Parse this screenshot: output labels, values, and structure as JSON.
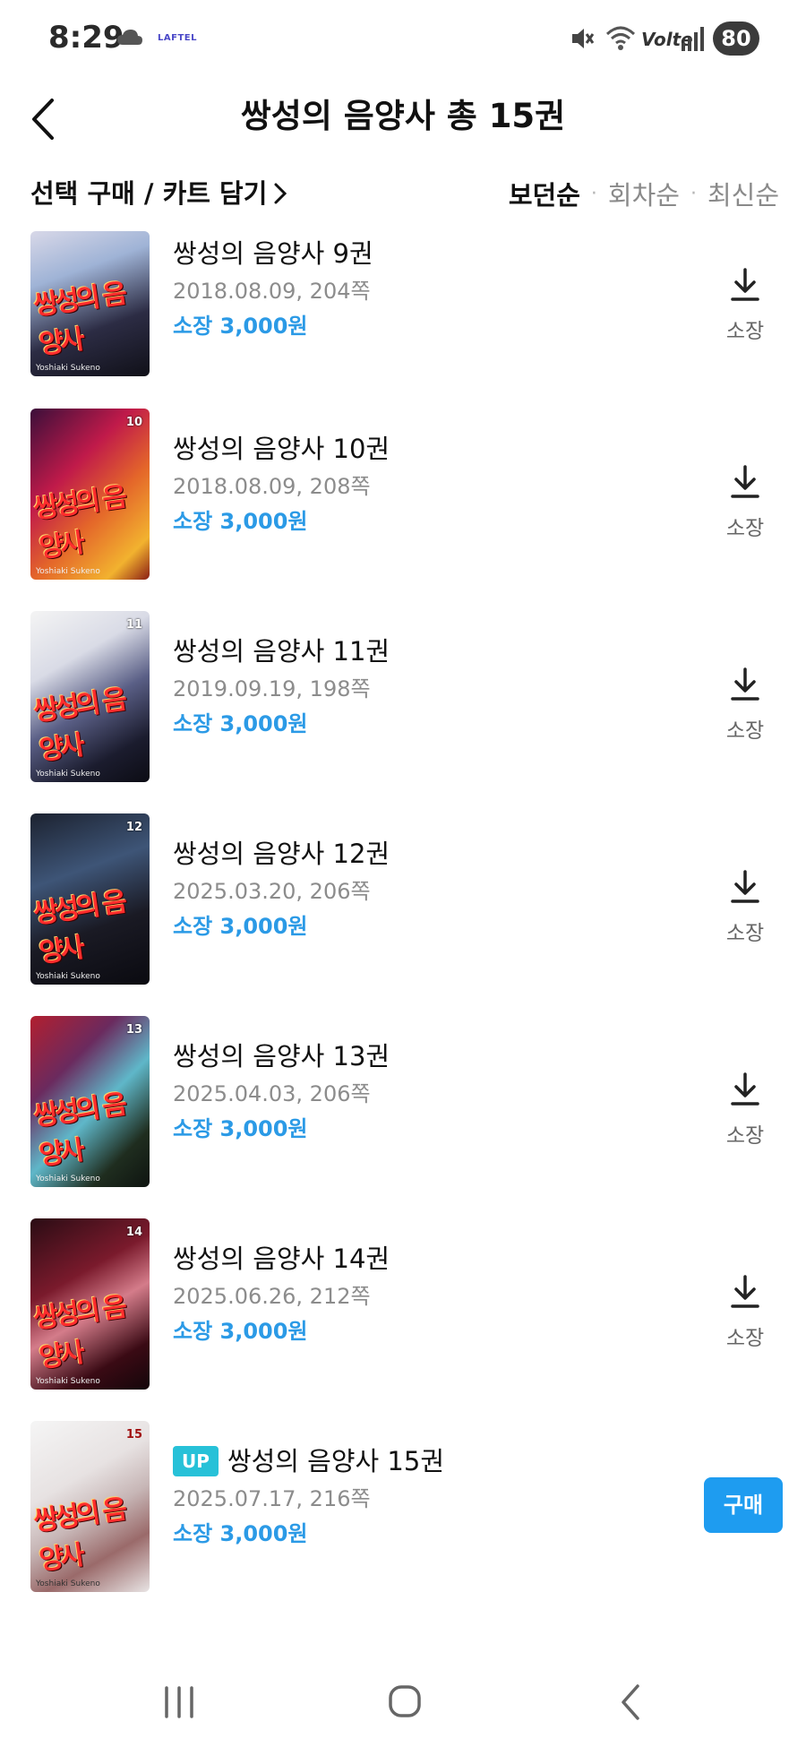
{
  "status_bar": {
    "time": "8:29",
    "app_label": "LAFTEL",
    "network": "Volte",
    "battery": "80"
  },
  "header": {
    "title": "쌍성의 음양사 총 15권"
  },
  "actions": {
    "select_label": "선택 구매 / 카트 담기",
    "sort_options": [
      "보던순",
      "회차순",
      "최신순"
    ]
  },
  "colors": {
    "accent_blue": "#2b9ae6",
    "buy_blue": "#1e9cf0",
    "up_badge": "#27c1d8"
  },
  "books": [
    {
      "title": "쌍성의 음양사 9권",
      "meta": "2018.08.09, 204쪽",
      "price": "소장 3,000원",
      "action_label": "소장",
      "action": "download",
      "volume": "9",
      "cover_text": "쌍성의 음양사",
      "cover_author": "Yoshiaki Sukeno"
    },
    {
      "title": "쌍성의 음양사 10권",
      "meta": "2018.08.09, 208쪽",
      "price": "소장 3,000원",
      "action_label": "소장",
      "action": "download",
      "volume": "10",
      "cover_text": "쌍성의 음양사",
      "cover_author": "Yoshiaki Sukeno"
    },
    {
      "title": "쌍성의 음양사 11권",
      "meta": "2019.09.19, 198쪽",
      "price": "소장 3,000원",
      "action_label": "소장",
      "action": "download",
      "volume": "11",
      "cover_text": "쌍성의 음양사",
      "cover_author": "Yoshiaki Sukeno"
    },
    {
      "title": "쌍성의 음양사 12권",
      "meta": "2025.03.20, 206쪽",
      "price": "소장 3,000원",
      "action_label": "소장",
      "action": "download",
      "volume": "12",
      "cover_text": "쌍성의 음양사",
      "cover_author": "Yoshiaki Sukeno"
    },
    {
      "title": "쌍성의 음양사 13권",
      "meta": "2025.04.03, 206쪽",
      "price": "소장 3,000원",
      "action_label": "소장",
      "action": "download",
      "volume": "13",
      "cover_text": "쌍성의 음양사",
      "cover_author": "Yoshiaki Sukeno"
    },
    {
      "title": "쌍성의 음양사 14권",
      "meta": "2025.06.26, 212쪽",
      "price": "소장 3,000원",
      "action_label": "소장",
      "action": "download",
      "volume": "14",
      "cover_text": "쌍성의 음양사",
      "cover_author": "Yoshiaki Sukeno"
    },
    {
      "title": "쌍성의 음양사 15권",
      "meta": "2025.07.17, 216쪽",
      "price": "소장 3,000원",
      "badge": "UP",
      "action_label": "구매",
      "action": "buy",
      "volume": "15",
      "cover_text": "쌍성의 음양사",
      "cover_author": "Yoshiaki Sukeno"
    }
  ],
  "nav_bar": {
    "buttons": [
      "recent-apps-icon",
      "home-icon",
      "back-icon"
    ]
  }
}
